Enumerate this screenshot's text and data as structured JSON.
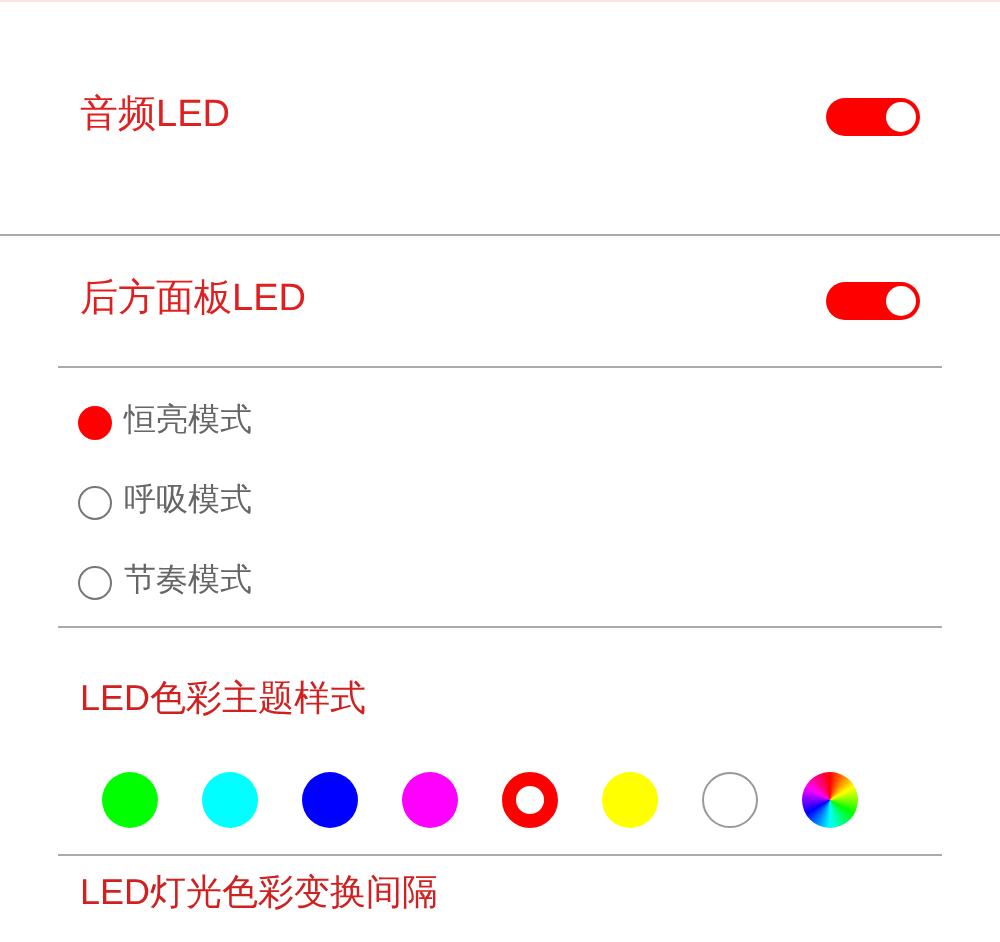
{
  "toggles": [
    {
      "label": "音频LED",
      "on": true
    },
    {
      "label": "后方面板LED",
      "on": true
    }
  ],
  "modes": [
    {
      "label": "恒亮模式",
      "selected": true
    },
    {
      "label": "呼吸模式",
      "selected": false
    },
    {
      "label": "节奏模式",
      "selected": false
    }
  ],
  "theme": {
    "title": "LED色彩主题样式",
    "swatches": [
      {
        "kind": "solid",
        "color": "#00ff00",
        "selected": false
      },
      {
        "kind": "solid",
        "color": "#00ffff",
        "selected": false
      },
      {
        "kind": "solid",
        "color": "#0000ff",
        "selected": false
      },
      {
        "kind": "solid",
        "color": "#ff00ff",
        "selected": false
      },
      {
        "kind": "solid",
        "color": "#ff0000",
        "selected": true
      },
      {
        "kind": "solid",
        "color": "#ffff00",
        "selected": false
      },
      {
        "kind": "solid",
        "color": "#ffffff",
        "selected": false
      },
      {
        "kind": "rainbow",
        "selected": false
      }
    ]
  },
  "interval": {
    "title": "LED灯光色彩变换间隔"
  }
}
